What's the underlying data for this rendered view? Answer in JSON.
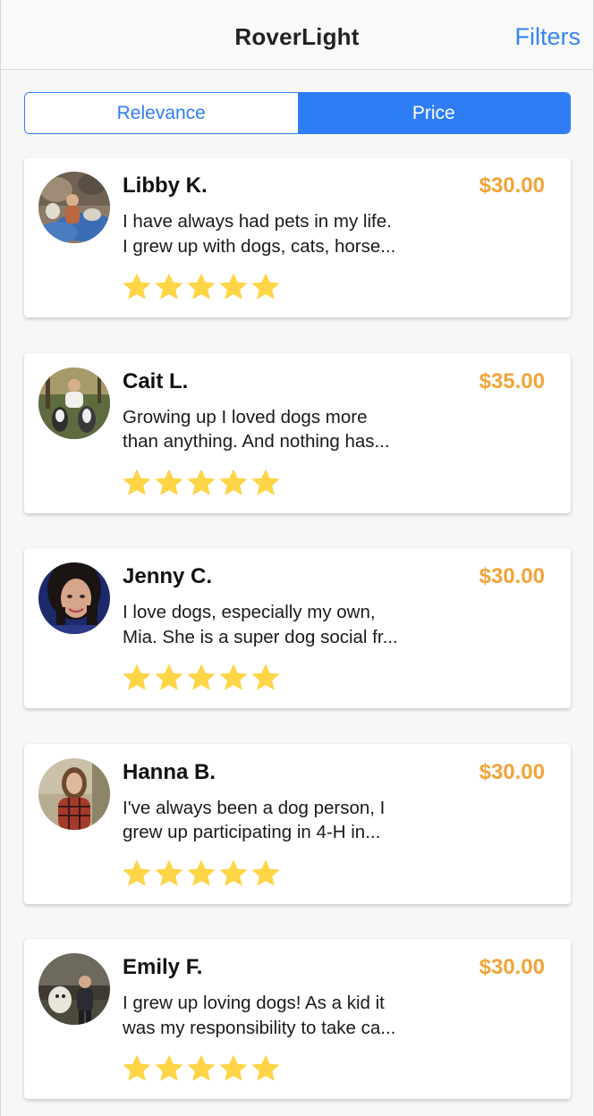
{
  "header": {
    "title": "RoverLight",
    "filters_label": "Filters"
  },
  "sort": {
    "options": [
      "Relevance",
      "Price"
    ],
    "selected": "Price"
  },
  "colors": {
    "accent": "#2f7df6",
    "price": "#f2a43a",
    "star": "#fed546"
  },
  "sitters": [
    {
      "name": "Libby K.",
      "price": "$30.00",
      "bio_line1": "I have always had pets in my life.",
      "bio_line2": "I grew up with dogs, cats, horse...",
      "rating": 5
    },
    {
      "name": "Cait L.",
      "price": "$35.00",
      "bio_line1": "Growing up I loved dogs more",
      "bio_line2": "than anything. And nothing has...",
      "rating": 5
    },
    {
      "name": "Jenny C.",
      "price": "$30.00",
      "bio_line1": "I love dogs, especially my own,",
      "bio_line2": "Mia. She is a super dog social fr...",
      "rating": 5
    },
    {
      "name": "Hanna B.",
      "price": "$30.00",
      "bio_line1": "I've always been a dog person, I",
      "bio_line2": "grew up participating in 4-H in...",
      "rating": 5
    },
    {
      "name": "Emily F.",
      "price": "$30.00",
      "bio_line1": "I grew up loving dogs! As a kid it",
      "bio_line2": "was my responsibility to take ca...",
      "rating": 5
    }
  ]
}
